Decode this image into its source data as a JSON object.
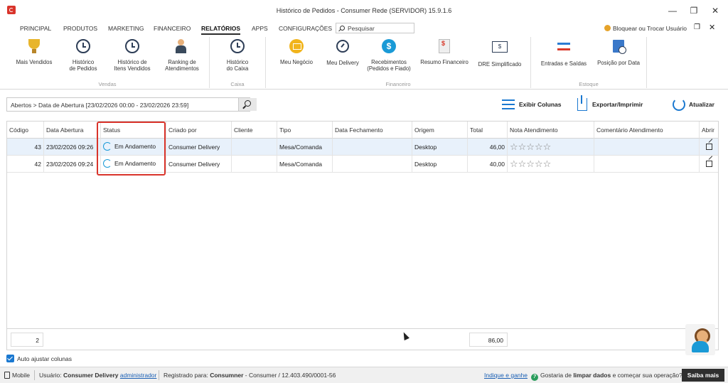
{
  "window": {
    "title": "Histórico de Pedidos - Consumer Rede (SERVIDOR) 15.9.1.6",
    "minimize": "—",
    "maximize": "❐",
    "close": "✕"
  },
  "menu": {
    "items": [
      "PRINCIPAL",
      "PRODUTOS",
      "MARKETING",
      "FINANCEIRO",
      "RELATÓRIOS",
      "APPS",
      "CONFIGURAÇÕES"
    ],
    "active": "RELATÓRIOS",
    "search_placeholder": "Pesquisar",
    "lock_user": "Bloquear ou Trocar Usuário",
    "restore": "❐",
    "close": "✕"
  },
  "ribbon": {
    "vendas": {
      "label": "Vendas",
      "buttons": [
        {
          "label": "Mais Vendidos",
          "icon": "trophy-icon"
        },
        {
          "label": "Histórico\nde Pedidos",
          "icon": "clock-icon"
        },
        {
          "label": "Histórico de\nItens Vendidos",
          "icon": "clock-icon"
        },
        {
          "label": "Ranking de\nAtendimentos",
          "icon": "waiter-icon"
        }
      ]
    },
    "caixa": {
      "label": "Caixa",
      "buttons": [
        {
          "label": "Histórico\ndo Caixa",
          "icon": "clock-icon"
        }
      ]
    },
    "financeiro": {
      "label": "Financeiro",
      "buttons": [
        {
          "label": "Meu Negócio",
          "icon": "dashboard-icon"
        },
        {
          "label": "Meu Delivery",
          "icon": "delivery-icon"
        },
        {
          "label": "Recebimentos\n(Pedidos e Fiado)",
          "icon": "dollar-icon"
        },
        {
          "label": "Resumo Financeiro",
          "icon": "report-icon"
        },
        {
          "label": "DRE Simplificado",
          "icon": "dre-icon"
        }
      ]
    },
    "estoque": {
      "label": "Estoque",
      "buttons": [
        {
          "label": "Entradas e Saídas",
          "icon": "arrows-icon"
        },
        {
          "label": "Posição por Data",
          "icon": "position-icon"
        }
      ]
    }
  },
  "filter": {
    "text": "Abertos > Data de Abertura [23/02/2026 00:00 - 23/02/2026 23:59]"
  },
  "toolbar": {
    "columns": "Exibir Colunas",
    "export": "Exportar/Imprimir",
    "refresh": "Atualizar"
  },
  "grid": {
    "columns": [
      "Código",
      "Data Abertura",
      "Status",
      "Criado por",
      "Cliente",
      "Tipo",
      "Data Fechamento",
      "Origem",
      "Total",
      "Nota Atendimento",
      "Comentário Atendimento",
      "Abrir"
    ],
    "rows": [
      {
        "codigo": "43",
        "data_abertura": "23/02/2026 09:26",
        "status": "Em Andamento",
        "criado_por": "Consumer Delivery",
        "cliente": "",
        "tipo": "Mesa/Comanda",
        "data_fechamento": "",
        "origem": "Desktop",
        "total": "46,00",
        "nota": "☆☆☆☆☆",
        "comentario": ""
      },
      {
        "codigo": "42",
        "data_abertura": "23/02/2026 09:24",
        "status": "Em Andamento",
        "criado_por": "Consumer Delivery",
        "cliente": "",
        "tipo": "Mesa/Comanda",
        "data_fechamento": "",
        "origem": "Desktop",
        "total": "40,00",
        "nota": "☆☆☆☆☆",
        "comentario": ""
      }
    ],
    "footer_count": "2",
    "footer_total": "86,00"
  },
  "auto_adjust": "Auto ajustar colunas",
  "statusbar": {
    "mobile": "Mobile",
    "user_prefix": "Usuário: ",
    "user_name": "Consumer Delivery",
    "user_role": "administrador",
    "registered_prefix": "Registrado para: ",
    "registered_name": "Consumner",
    "registered_rest": " - Consumer / 12.403.490/0001-56",
    "indique": "Indique e ganhe",
    "question_pre": "Gostaria de ",
    "question_bold": "limpar dados",
    "question_post": " e começar sua operação?",
    "saiba_mais": "Saiba mais"
  },
  "colors": {
    "accent": "#1a78d0",
    "highlight": "#d9342b"
  }
}
